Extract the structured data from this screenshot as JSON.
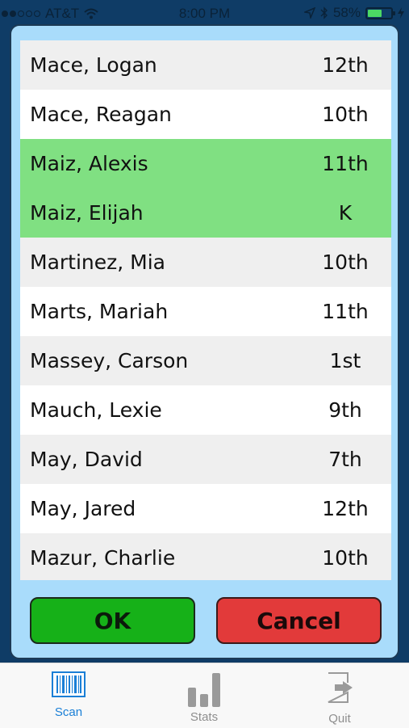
{
  "status": {
    "carrier": "AT&T",
    "time": "8:00 PM",
    "battery": "58%",
    "battery_level": 0.58
  },
  "students": [
    {
      "name": "Mace, Logan",
      "grade": "12th",
      "selected": false
    },
    {
      "name": "Mace, Reagan",
      "grade": "10th",
      "selected": false
    },
    {
      "name": "Maiz, Alexis",
      "grade": "11th",
      "selected": true
    },
    {
      "name": "Maiz, Elijah",
      "grade": "K",
      "selected": true
    },
    {
      "name": "Martinez, Mia",
      "grade": "10th",
      "selected": false
    },
    {
      "name": "Marts, Mariah",
      "grade": "11th",
      "selected": false
    },
    {
      "name": "Massey, Carson",
      "grade": "1st",
      "selected": false
    },
    {
      "name": "Mauch, Lexie",
      "grade": "9th",
      "selected": false
    },
    {
      "name": "May, David",
      "grade": "7th",
      "selected": false
    },
    {
      "name": "May, Jared",
      "grade": "12th",
      "selected": false
    },
    {
      "name": "Mazur, Charlie",
      "grade": "10th",
      "selected": false
    }
  ],
  "buttons": {
    "ok": "OK",
    "cancel": "Cancel"
  },
  "tabs": {
    "scan": {
      "label": "Scan",
      "icon": "barcode-icon",
      "active": true
    },
    "stats": {
      "label": "Stats",
      "icon": "bar-chart-icon",
      "active": false
    },
    "quit": {
      "label": "Quit",
      "icon": "exit-icon",
      "active": false
    }
  },
  "colors": {
    "selected_row": "#80e082",
    "ok_button": "#16b118",
    "cancel_button": "#e23a3a",
    "active_tab": "#1a7fd6"
  }
}
